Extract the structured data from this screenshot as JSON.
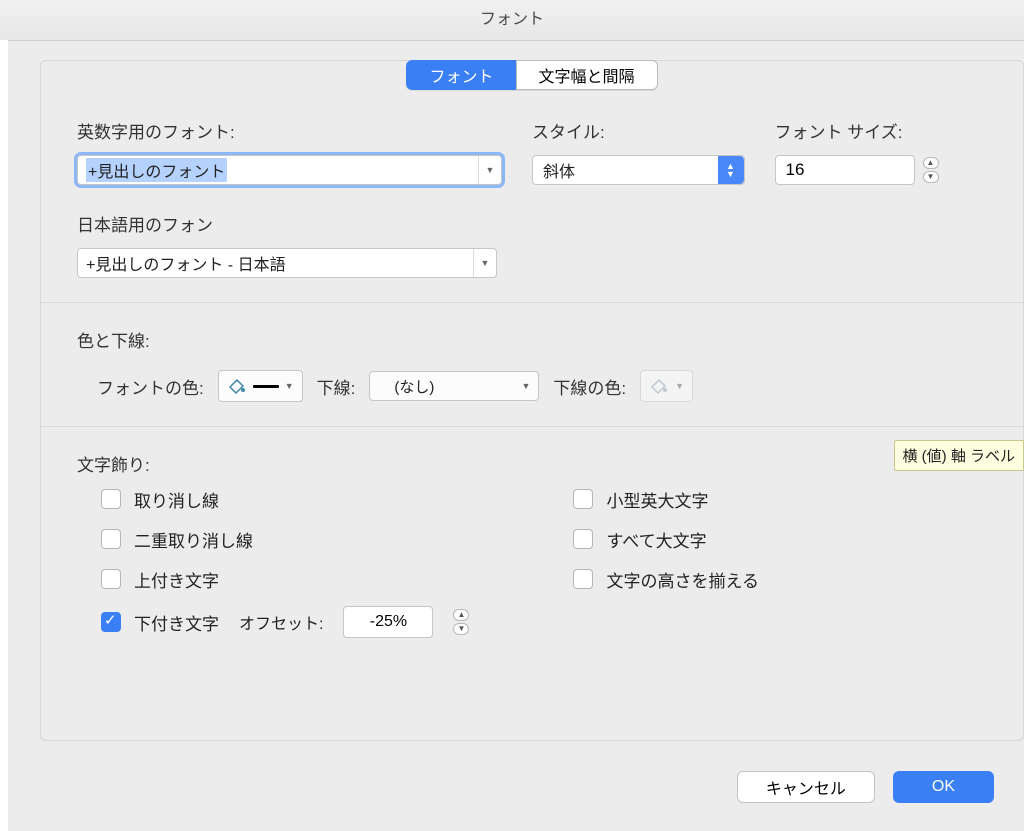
{
  "title": "フォント",
  "tabs": {
    "font": "フォント",
    "spacing": "文字幅と間隔"
  },
  "labels": {
    "latinFont": "英数字用のフォント:",
    "style": "スタイル:",
    "size": "フォント サイズ:",
    "japaneseFont": "日本語用のフォン",
    "colorUnderline": "色と下線:",
    "fontColor": "フォントの色:",
    "underline": "下線:",
    "underlineColor": "下線の色:",
    "effects": "文字飾り:",
    "offset": "オフセット:"
  },
  "values": {
    "latinFont": "+見出しのフォント",
    "style": "斜体",
    "size": "16",
    "japaneseFont": "+見出しのフォント - 日本語",
    "underline": "(なし)",
    "offset": "-25%"
  },
  "effects": {
    "left": [
      {
        "key": "strike",
        "label": "取り消し線",
        "checked": false
      },
      {
        "key": "dstrike",
        "label": "二重取り消し線",
        "checked": false
      },
      {
        "key": "super",
        "label": "上付き文字",
        "checked": false
      },
      {
        "key": "sub",
        "label": "下付き文字",
        "checked": true
      }
    ],
    "right": [
      {
        "key": "smallcaps",
        "label": "小型英大文字",
        "checked": false
      },
      {
        "key": "allcaps",
        "label": "すべて大文字",
        "checked": false
      },
      {
        "key": "equalize",
        "label": "文字の高さを揃える",
        "checked": false
      }
    ]
  },
  "buttons": {
    "cancel": "キャンセル",
    "ok": "OK"
  },
  "tooltip": "横 (値) 軸 ラベル"
}
